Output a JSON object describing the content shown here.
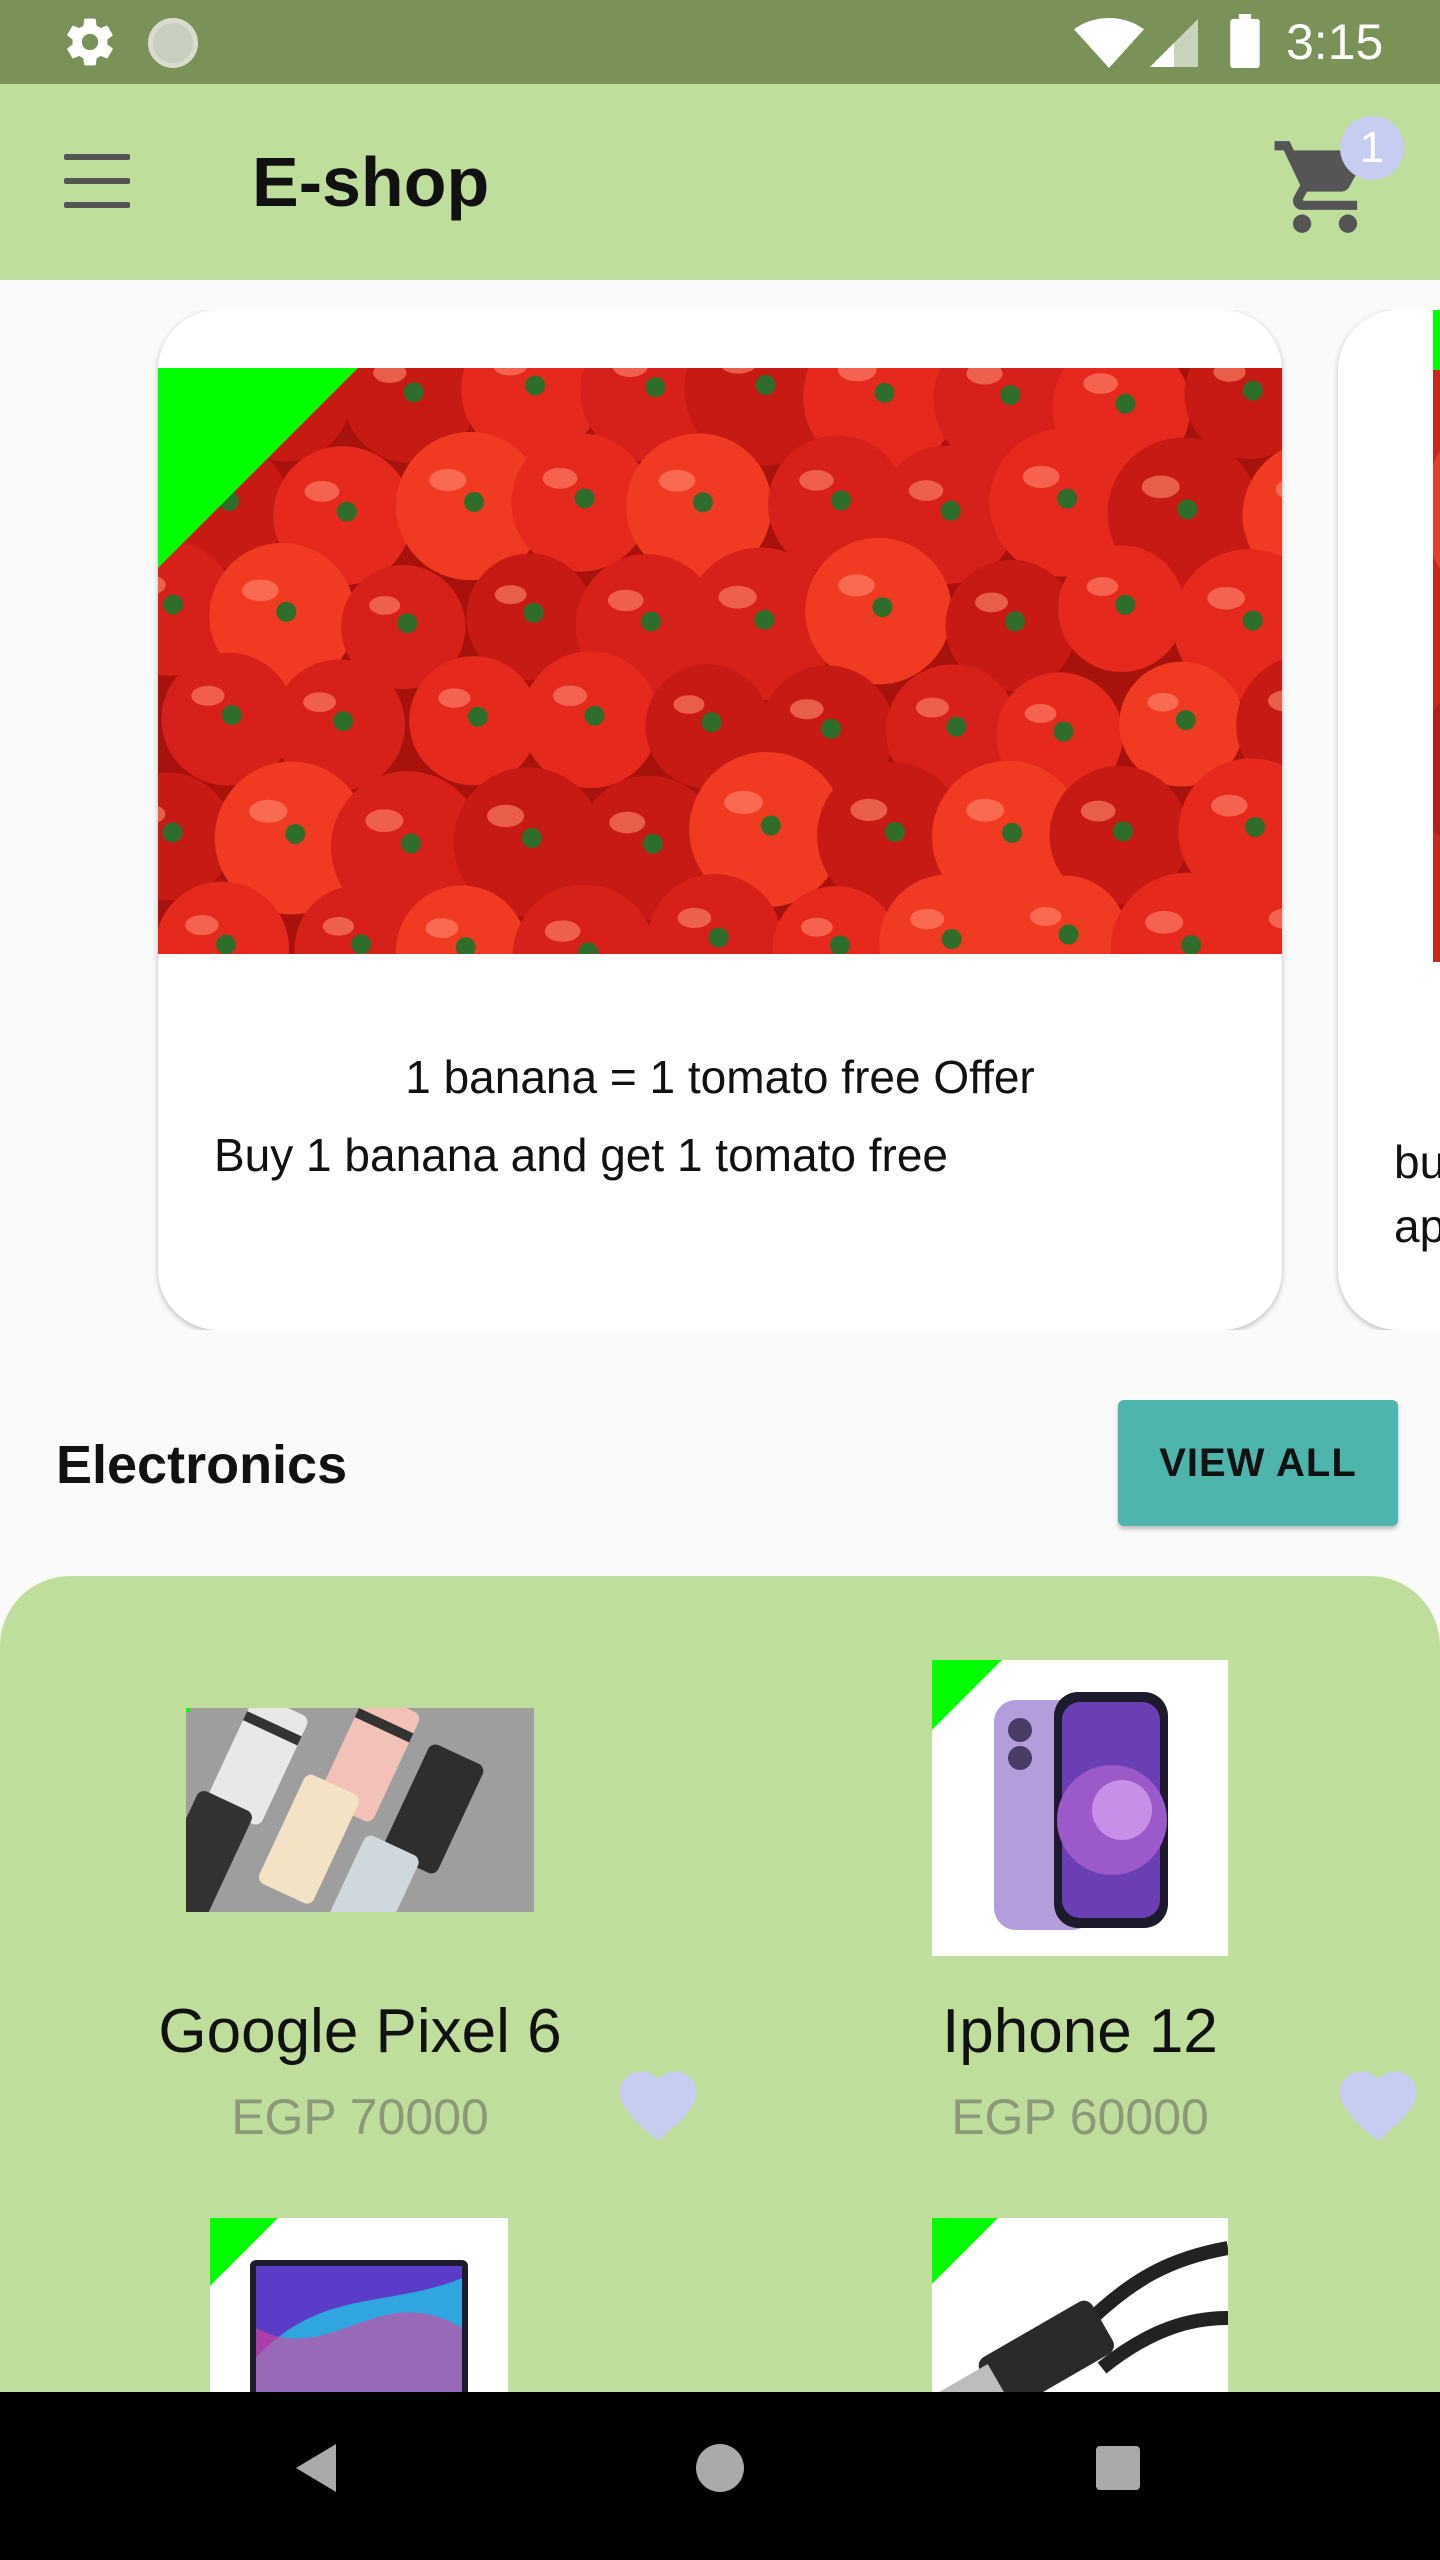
{
  "status_bar": {
    "time": "3:15",
    "icons": [
      "gear-icon",
      "loading-icon",
      "wifi-icon",
      "signal-icon",
      "battery-icon"
    ]
  },
  "app_bar": {
    "title": "E-shop",
    "cart_count": "1",
    "icons": [
      "menu-icon",
      "cart-icon"
    ]
  },
  "offers": [
    {
      "title": "1 banana = 1 tomato free Offer",
      "description": "Buy 1 banana and get 1 tomato free",
      "image": "tomatoes"
    },
    {
      "text": "bu\nap",
      "image": "red-fruit"
    }
  ],
  "section": {
    "title": "Electronics",
    "view_all_label": "VIEW ALL"
  },
  "products": [
    {
      "name": "Google Pixel 6",
      "price": "EGP 70000",
      "image": "pixel-phones"
    },
    {
      "name": "Iphone 12",
      "price": "EGP 60000",
      "image": "purple-iphone"
    },
    {
      "name": "",
      "price": "",
      "image": "laptop"
    },
    {
      "name": "",
      "price": "",
      "image": "usb-cable"
    }
  ],
  "colors": {
    "status_bar": "#7a9158",
    "app_bar": "#bfde9b",
    "accent_button": "#4db5ac",
    "badge": "#c6cdf0",
    "corner_tag": "#00ff00",
    "heart": "#c6cdf0",
    "price": "#8a9a78"
  }
}
